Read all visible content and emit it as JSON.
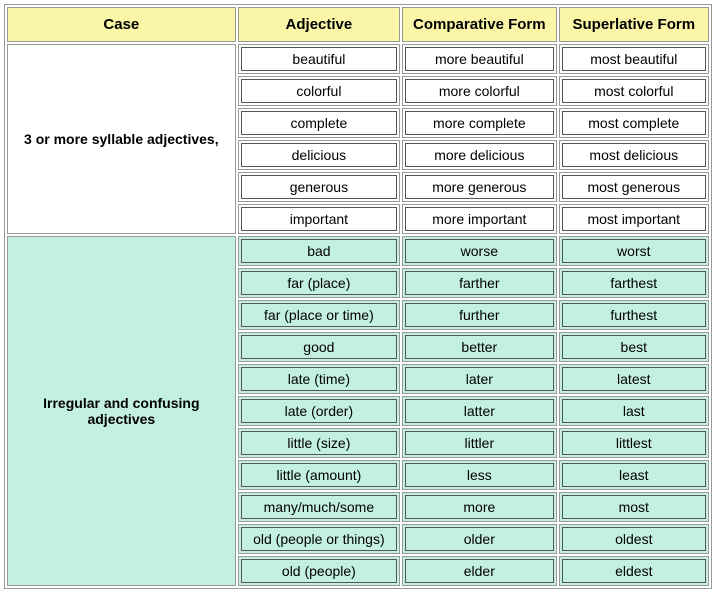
{
  "headers": {
    "case": "Case",
    "adjective": "Adjective",
    "comparative": "Comparative Form",
    "superlative": "Superlative Form"
  },
  "sections": [
    {
      "case_label": "3 or more syllable adjectives,",
      "bg": "white",
      "rows": [
        {
          "adj": "beautiful",
          "cmp": "more beautiful",
          "sup": "most beautiful"
        },
        {
          "adj": "colorful",
          "cmp": "more colorful",
          "sup": "most colorful"
        },
        {
          "adj": "complete",
          "cmp": "more complete",
          "sup": "most complete"
        },
        {
          "adj": "delicious",
          "cmp": "more delicious",
          "sup": "most delicious"
        },
        {
          "adj": "generous",
          "cmp": "more generous",
          "sup": "most generous"
        },
        {
          "adj": "important",
          "cmp": "more important",
          "sup": "most important"
        }
      ]
    },
    {
      "case_label": "Irregular and confusing adjectives",
      "bg": "mint",
      "rows": [
        {
          "adj": "bad",
          "cmp": "worse",
          "sup": "worst"
        },
        {
          "adj": "far (place)",
          "cmp": "farther",
          "sup": "farthest"
        },
        {
          "adj": "far (place or time)",
          "cmp": "further",
          "sup": "furthest"
        },
        {
          "adj": "good",
          "cmp": "better",
          "sup": "best"
        },
        {
          "adj": "late (time)",
          "cmp": "later",
          "sup": "latest"
        },
        {
          "adj": "late (order)",
          "cmp": "latter",
          "sup": "last"
        },
        {
          "adj": "little (size)",
          "cmp": "littler",
          "sup": "littlest"
        },
        {
          "adj": "little (amount)",
          "cmp": "less",
          "sup": "least"
        },
        {
          "adj": "many/much/some",
          "cmp": "more",
          "sup": "most"
        },
        {
          "adj": "old (people or things)",
          "cmp": "older",
          "sup": "oldest",
          "tall": true
        },
        {
          "adj": "old (people)",
          "cmp": "elder",
          "sup": "eldest"
        }
      ]
    }
  ]
}
